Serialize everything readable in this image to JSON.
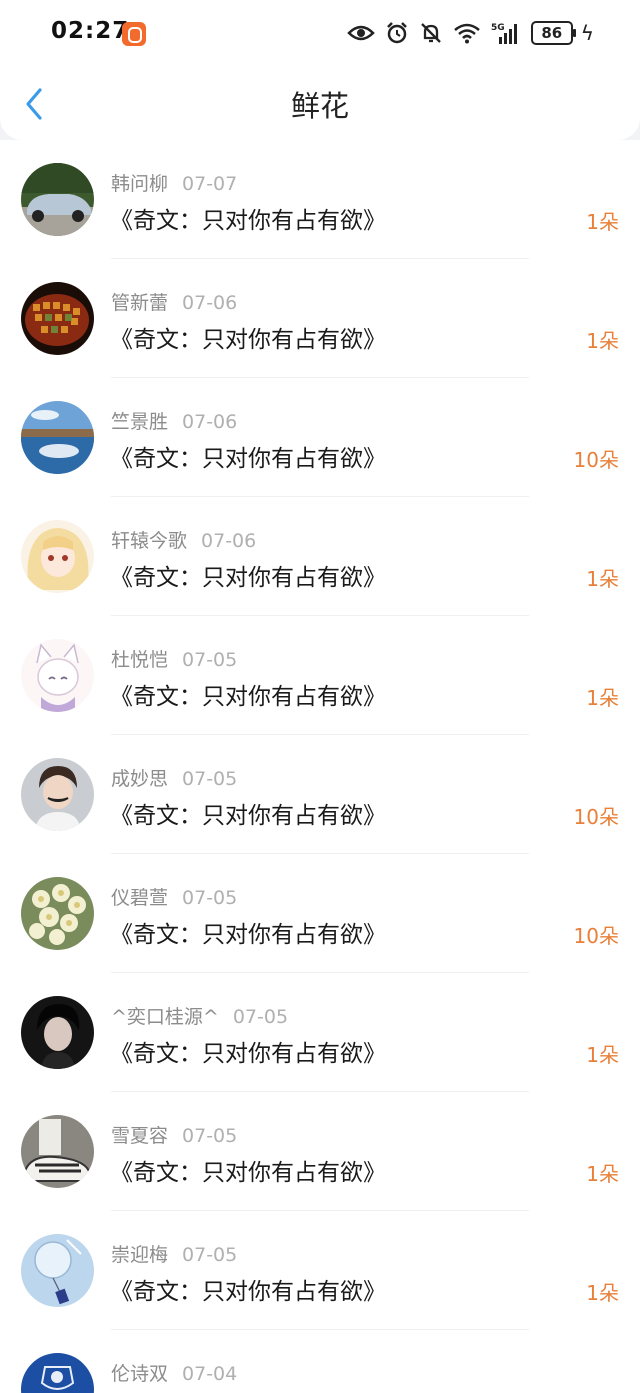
{
  "status": {
    "time": "02:27",
    "battery": "86",
    "network": "5G"
  },
  "nav": {
    "title": "鲜花"
  },
  "colors": {
    "accent": "#e8803a",
    "back": "#3a9be8"
  },
  "items": [
    {
      "name": "韩问柳",
      "date": "07-07",
      "book": "《奇文：只对你有占有欲》",
      "flowers": "1朵",
      "avatar": "car"
    },
    {
      "name": "管新蕾",
      "date": "07-06",
      "book": "《奇文：只对你有占有欲》",
      "flowers": "1朵",
      "avatar": "mosaic"
    },
    {
      "name": "竺景胜",
      "date": "07-06",
      "book": "《奇文：只对你有占有欲》",
      "flowers": "10朵",
      "avatar": "lake"
    },
    {
      "name": "轩辕今歌",
      "date": "07-06",
      "book": "《奇文：只对你有占有欲》",
      "flowers": "1朵",
      "avatar": "anime-girl"
    },
    {
      "name": "杜悦恺",
      "date": "07-05",
      "book": "《奇文：只对你有占有欲》",
      "flowers": "1朵",
      "avatar": "cat-girl"
    },
    {
      "name": "成妙思",
      "date": "07-05",
      "book": "《奇文：只对你有占有欲》",
      "flowers": "10朵",
      "avatar": "boy"
    },
    {
      "name": "仪碧萱",
      "date": "07-05",
      "book": "《奇文：只对你有占有欲》",
      "flowers": "10朵",
      "avatar": "flowers"
    },
    {
      "name": "^奕口桂源^",
      "date": "07-05",
      "book": "《奇文：只对你有占有欲》",
      "flowers": "1朵",
      "avatar": "dark-boy"
    },
    {
      "name": "雪夏容",
      "date": "07-05",
      "book": "《奇文：只对你有占有欲》",
      "flowers": "1朵",
      "avatar": "shoes"
    },
    {
      "name": "崇迎梅",
      "date": "07-05",
      "book": "《奇文：只对你有占有欲》",
      "flowers": "1朵",
      "avatar": "wind-chime"
    },
    {
      "name": "伦诗双",
      "date": "07-04",
      "book": "",
      "flowers": "",
      "avatar": "badge"
    }
  ]
}
